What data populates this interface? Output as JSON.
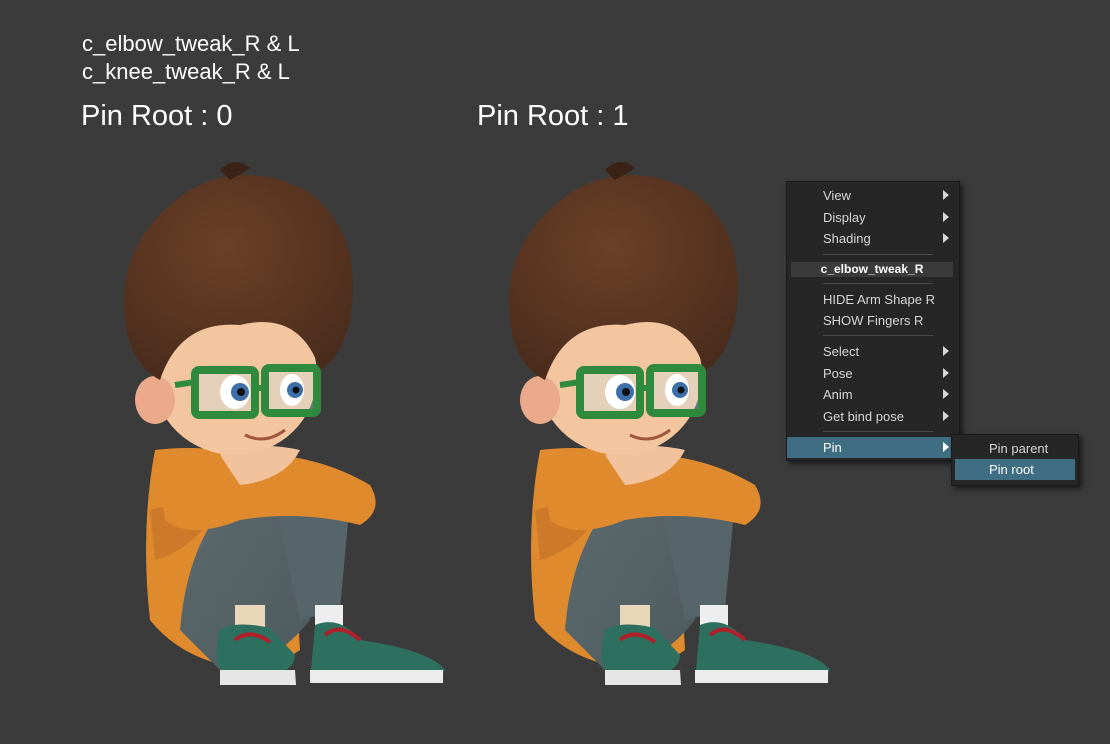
{
  "caption": {
    "line1": "c_elbow_tweak_R & L",
    "line2": "c_knee_tweak_R & L"
  },
  "panels": [
    {
      "title": "Pin Root : 0"
    },
    {
      "title": "Pin Root : 1"
    }
  ],
  "context_menu": {
    "items_top": [
      {
        "label": "View",
        "submenu": true
      },
      {
        "label": "Display",
        "submenu": true
      },
      {
        "label": "Shading",
        "submenu": true
      }
    ],
    "header": "c_elbow_tweak_R",
    "items_mid": [
      {
        "label": "HIDE Arm Shape R",
        "submenu": false
      },
      {
        "label": "SHOW Fingers R",
        "submenu": false
      }
    ],
    "items_bottom": [
      {
        "label": "Select",
        "submenu": true
      },
      {
        "label": "Pose",
        "submenu": true
      },
      {
        "label": "Anim",
        "submenu": true
      },
      {
        "label": "Get bind pose",
        "submenu": true
      }
    ],
    "pin": {
      "label": "Pin",
      "submenu": true,
      "active": true
    },
    "submenu": {
      "items": [
        {
          "label": "Pin parent",
          "active": false
        },
        {
          "label": "Pin root",
          "active": true
        }
      ]
    }
  },
  "colors": {
    "background": "#3b3b3b",
    "menu_bg": "#262626",
    "menu_highlight": "#3f6d82",
    "sweater": "#e08a2e",
    "pants": "#4d5a5e",
    "hair": "#4a2c1c",
    "glasses": "#2f8a3e"
  }
}
